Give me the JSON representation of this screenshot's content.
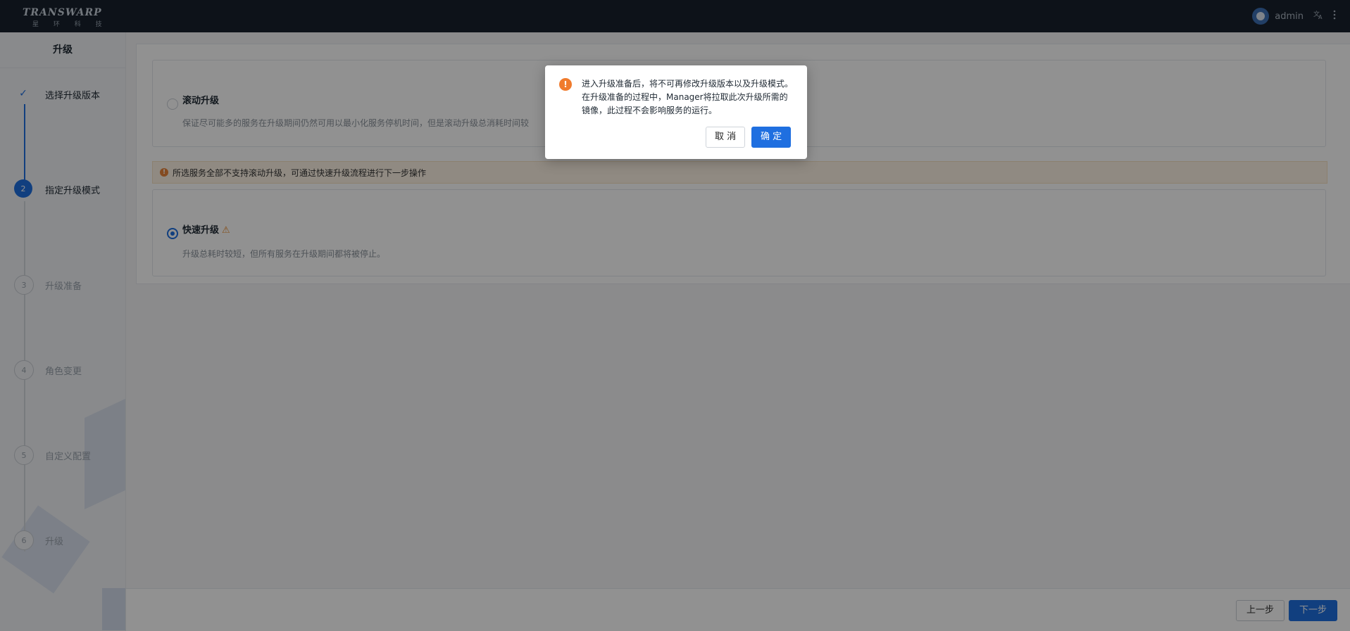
{
  "header": {
    "logo_main": "TRANSWARP",
    "logo_sub": "星 环 科 技",
    "user_name": "admin",
    "translate_icon": "translate-icon",
    "more_icon": "more-vertical-icon"
  },
  "sidebar": {
    "title": "升级",
    "steps": [
      {
        "number": "✓",
        "label": "选择升级版本",
        "state": "done"
      },
      {
        "number": "2",
        "label": "指定升级模式",
        "state": "active"
      },
      {
        "number": "3",
        "label": "升级准备",
        "state": "pending"
      },
      {
        "number": "4",
        "label": "角色变更",
        "state": "pending"
      },
      {
        "number": "5",
        "label": "自定义配置",
        "state": "pending"
      },
      {
        "number": "6",
        "label": "升级",
        "state": "pending"
      }
    ]
  },
  "main": {
    "rolling": {
      "title": "滚动升级",
      "description": "保证尽可能多的服务在升级期间仍然可用以最小化服务停机时间，但是滚动升级总消耗时间较",
      "selected": false
    },
    "alert": "所选服务全部不支持滚动升级，可通过快速升级流程进行下一步操作",
    "quick": {
      "title": "快速升级",
      "description": "升级总耗时较短，但所有服务在升级期间都将被停止。",
      "selected": true,
      "warn_icon": "warning-triangle-icon"
    },
    "footer": {
      "prev_label": "上一步",
      "next_label": "下一步"
    }
  },
  "modal": {
    "icon": "exclamation-icon",
    "message": "进入升级准备后，将不可再修改升级版本以及升级模式。在升级准备的过程中，Manager将拉取此次升级所需的镜像，此过程不会影响服务的运行。",
    "cancel_label": "取 消",
    "ok_label": "确 定"
  },
  "colors": {
    "primary": "#1f6fe0",
    "topbar": "#17212c",
    "warning": "#f07b2d"
  }
}
